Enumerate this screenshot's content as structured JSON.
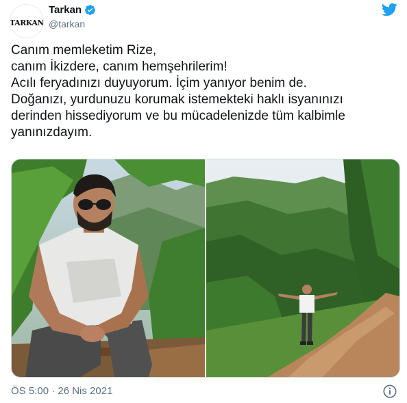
{
  "header": {
    "display_name": "Tarkan",
    "handle": "@tarkan",
    "avatar_text": "TARKAN",
    "verified_icon": "verified-badge-icon",
    "logo_icon": "twitter-bird-icon"
  },
  "tweet": {
    "lines": [
      "Canım memleketim Rize,",
      "canım İkizdere, canım hemşehrilerim!",
      "Acılı feryadınızı duyuyorum. İçim yanıyor benim de.",
      "Doğanızı, yurdunuzu korumak istemekteki haklı isyanınızı",
      "derinden hissediyorum ve bu mücadelenizde tüm kalbimle",
      "yanınızdayım."
    ]
  },
  "media": {
    "photos": [
      {
        "description_icon": "photo-man-sitting-in-forest"
      },
      {
        "description_icon": "photo-man-on-mountain-road"
      }
    ]
  },
  "footer": {
    "timestamp": "ÖS 5:00 · 26 Nis 2021",
    "info_icon": "info-icon"
  },
  "colors": {
    "twitter_blue": "#1da1f2",
    "text": "#0f1419",
    "secondary": "#5b7083"
  }
}
